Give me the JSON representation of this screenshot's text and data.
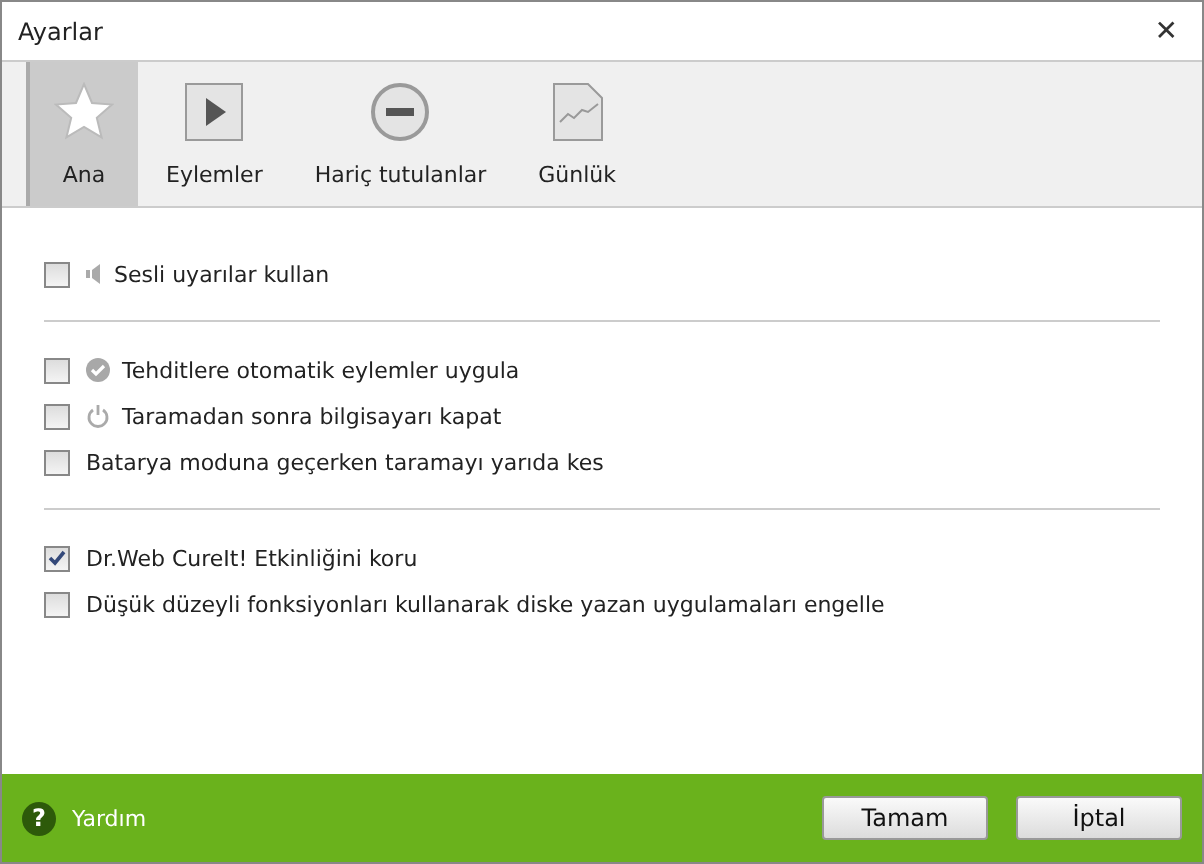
{
  "window": {
    "title": "Ayarlar",
    "close": "✕"
  },
  "tabs": [
    {
      "label": "Ana",
      "kind": "star",
      "selected": true
    },
    {
      "label": "Eylemler",
      "kind": "play",
      "selected": false
    },
    {
      "label": "Hariç tutulanlar",
      "kind": "minus",
      "selected": false
    },
    {
      "label": "Günlük",
      "kind": "chart",
      "selected": false
    }
  ],
  "groups": [
    [
      {
        "label": "Sesli uyarılar kullan",
        "kind": "speaker",
        "checked": false
      }
    ],
    [
      {
        "label": "Tehditlere otomatik eylemler uygula",
        "kind": "check",
        "checked": false
      },
      {
        "label": "Taramadan sonra bilgisayarı kapat",
        "kind": "power",
        "checked": false
      },
      {
        "label": "Batarya moduna geçerken taramayı yarıda kes",
        "kind": "plain",
        "checked": false
      }
    ],
    [
      {
        "label": "Dr.Web CureIt! Etkinliğini koru",
        "kind": "plain",
        "checked": true
      },
      {
        "label": "Düşük düzeyli fonksiyonları kullanarak diske yazan uygulamaları engelle",
        "kind": "plain",
        "checked": false
      }
    ]
  ],
  "footer": {
    "help_icon": "?",
    "help": "Yardım",
    "buttons": [
      "Tamam",
      "İptal"
    ]
  }
}
